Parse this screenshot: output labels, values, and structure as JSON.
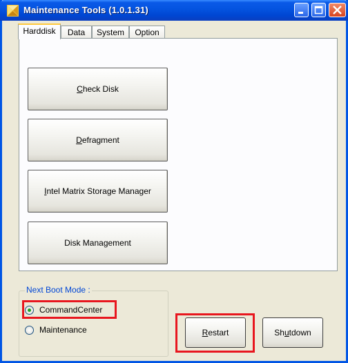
{
  "window": {
    "title": "Maintenance Tools (1.0.1.31)",
    "titlebar_color": "#0046d2",
    "controls": [
      "minimize-icon",
      "maximize-icon",
      "close-icon"
    ]
  },
  "tabs": [
    {
      "label": "Harddisk",
      "active": true
    },
    {
      "label": "Data",
      "active": false
    },
    {
      "label": "System",
      "active": false
    },
    {
      "label": "Option",
      "active": false
    }
  ],
  "harddisk_buttons": [
    {
      "prefix": "",
      "mnemonic": "C",
      "rest": "heck Disk"
    },
    {
      "prefix": "",
      "mnemonic": "D",
      "rest": "efragment"
    },
    {
      "prefix": "",
      "mnemonic": "I",
      "rest": "ntel Matrix Storage Manager"
    },
    {
      "prefix": "Disk Management",
      "mnemonic": "",
      "rest": ""
    }
  ],
  "boot_mode": {
    "label": "Next Boot Mode :",
    "options": [
      {
        "label": "CommandCenter",
        "checked": true
      },
      {
        "label": "Maintenance",
        "checked": false
      }
    ]
  },
  "actions": {
    "restart": {
      "prefix": "",
      "mnemonic": "R",
      "rest": "estart"
    },
    "shutdown": {
      "prefix": "Sh",
      "mnemonic": "u",
      "rest": "tdown"
    }
  },
  "highlight_color": "#e8161e"
}
